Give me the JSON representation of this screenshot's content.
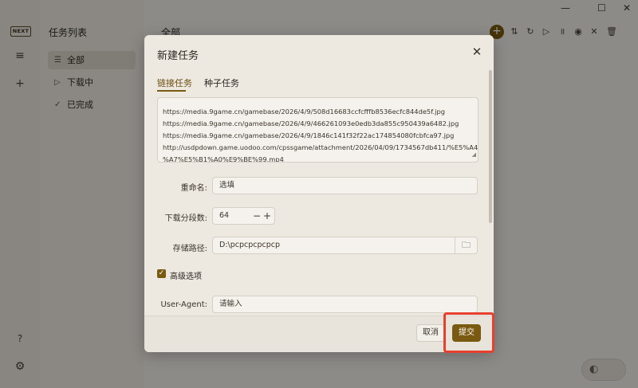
{
  "app": {
    "logo": "NEXT",
    "sidebar_title": "任务列表",
    "nav": [
      {
        "label": "全部",
        "icon": "list-icon"
      },
      {
        "label": "下载中",
        "icon": "play-icon"
      },
      {
        "label": "已完成",
        "icon": "check-icon"
      }
    ],
    "main_title": "全部",
    "accent": "#7a5a10"
  },
  "dialog": {
    "title": "新建任务",
    "tabs": [
      {
        "label": "链接任务",
        "active": true
      },
      {
        "label": "种子任务",
        "active": false
      }
    ],
    "urls": [
      "https://media.9game.cn/gamebase/2026/4/9/508d16683ccfcfffb8536ecfc844de5f.jpg",
      "https://media.9game.cn/gamebase/2026/4/9/466261093e0edb3da855c950439a6482.jpg",
      "https://media.9game.cn/gamebase/2026/4/9/1846c141f32f22ac174854080fcbfca97.jpg",
      "http://usdpdown.game.uodoo.com/cpssgame/attachment/2026/04/09/1734567db411/%E5%A4",
      "%A7%E5%B1%A0%E9%BE%99.mp4"
    ],
    "rename": {
      "label": "重命名:",
      "placeholder": "选填"
    },
    "segments": {
      "label": "下载分段数:",
      "value": "64",
      "minus": "−",
      "plus": "+"
    },
    "save_path": {
      "label": "存储路径:",
      "value": "D:\\pcpcpcpcpcp"
    },
    "advanced": {
      "label": "高级选项",
      "checked": true
    },
    "user_agent": {
      "label": "User-Agent:",
      "placeholder": "请输入"
    },
    "cancel_label": "取消",
    "submit_label": "提交"
  },
  "highlight_color": "#e8402f"
}
